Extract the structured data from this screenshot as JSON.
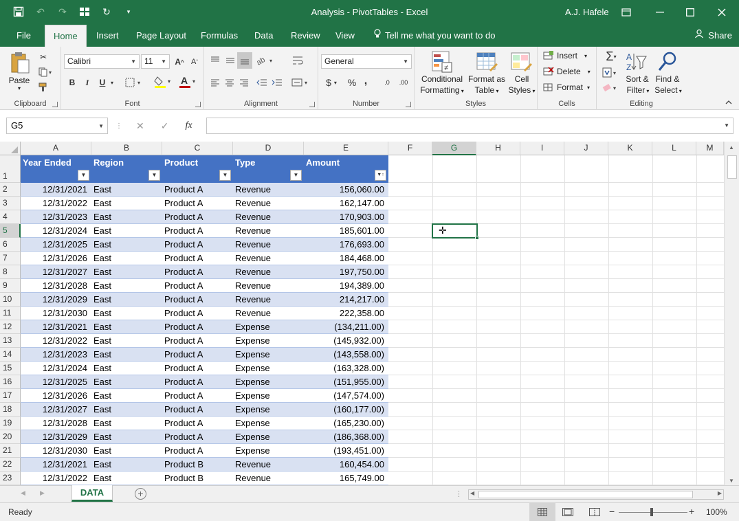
{
  "window": {
    "title": "Analysis - PivotTables  -  Excel",
    "user": "A.J. Hafele"
  },
  "tabs": [
    "File",
    "Home",
    "Insert",
    "Page Layout",
    "Formulas",
    "Data",
    "Review",
    "View"
  ],
  "tell_me": "Tell me what you want to do",
  "share": "Share",
  "ribbon": {
    "clipboard": {
      "paste": "Paste",
      "label": "Clipboard"
    },
    "font": {
      "name": "Calibri",
      "size": "11",
      "label": "Font",
      "bold": "B",
      "italic": "I",
      "underline": "U"
    },
    "alignment": {
      "label": "Alignment"
    },
    "number": {
      "format": "General",
      "label": "Number",
      "currency": "$",
      "percent": "%",
      "comma": ",",
      "inc_decimal": ".0",
      "dec_decimal": ".00"
    },
    "styles": {
      "conditional_1": "Conditional",
      "conditional_2": "Formatting",
      "format_table_1": "Format as",
      "format_table_2": "Table",
      "cell_styles_1": "Cell",
      "cell_styles_2": "Styles",
      "label": "Styles"
    },
    "cells": {
      "insert": "Insert",
      "delete": "Delete",
      "format": "Format",
      "label": "Cells"
    },
    "editing": {
      "sort_1": "Sort &",
      "sort_2": "Filter",
      "find_1": "Find &",
      "find_2": "Select",
      "label": "Editing"
    }
  },
  "namebox": "G5",
  "columns": [
    "A",
    "B",
    "C",
    "D",
    "E",
    "F",
    "G",
    "H",
    "I",
    "J",
    "K",
    "L",
    "M"
  ],
  "table": {
    "headers": [
      "Year Ended",
      "Region",
      "Product",
      "Type",
      "Amount"
    ],
    "rows": [
      [
        "12/31/2021",
        "East",
        "Product A",
        "Revenue",
        "156,060.00"
      ],
      [
        "12/31/2022",
        "East",
        "Product A",
        "Revenue",
        "162,147.00"
      ],
      [
        "12/31/2023",
        "East",
        "Product A",
        "Revenue",
        "170,903.00"
      ],
      [
        "12/31/2024",
        "East",
        "Product A",
        "Revenue",
        "185,601.00"
      ],
      [
        "12/31/2025",
        "East",
        "Product A",
        "Revenue",
        "176,693.00"
      ],
      [
        "12/31/2026",
        "East",
        "Product A",
        "Revenue",
        "184,468.00"
      ],
      [
        "12/31/2027",
        "East",
        "Product A",
        "Revenue",
        "197,750.00"
      ],
      [
        "12/31/2028",
        "East",
        "Product A",
        "Revenue",
        "194,389.00"
      ],
      [
        "12/31/2029",
        "East",
        "Product A",
        "Revenue",
        "214,217.00"
      ],
      [
        "12/31/2030",
        "East",
        "Product A",
        "Revenue",
        "222,358.00"
      ],
      [
        "12/31/2021",
        "East",
        "Product A",
        "Expense",
        "(134,211.00)"
      ],
      [
        "12/31/2022",
        "East",
        "Product A",
        "Expense",
        "(145,932.00)"
      ],
      [
        "12/31/2023",
        "East",
        "Product A",
        "Expense",
        "(143,558.00)"
      ],
      [
        "12/31/2024",
        "East",
        "Product A",
        "Expense",
        "(163,328.00)"
      ],
      [
        "12/31/2025",
        "East",
        "Product A",
        "Expense",
        "(151,955.00)"
      ],
      [
        "12/31/2026",
        "East",
        "Product A",
        "Expense",
        "(147,574.00)"
      ],
      [
        "12/31/2027",
        "East",
        "Product A",
        "Expense",
        "(160,177.00)"
      ],
      [
        "12/31/2028",
        "East",
        "Product A",
        "Expense",
        "(165,230.00)"
      ],
      [
        "12/31/2029",
        "East",
        "Product A",
        "Expense",
        "(186,368.00)"
      ],
      [
        "12/31/2030",
        "East",
        "Product A",
        "Expense",
        "(193,451.00)"
      ],
      [
        "12/31/2021",
        "East",
        "Product B",
        "Revenue",
        "160,454.00"
      ],
      [
        "12/31/2022",
        "East",
        "Product B",
        "Revenue",
        "165,749.00"
      ]
    ]
  },
  "sheet_tab": "DATA",
  "status": "Ready",
  "zoom": "100%",
  "colors": {
    "excel_green": "#217346",
    "table_header": "#4472c4",
    "band": "#d9e1f2"
  }
}
